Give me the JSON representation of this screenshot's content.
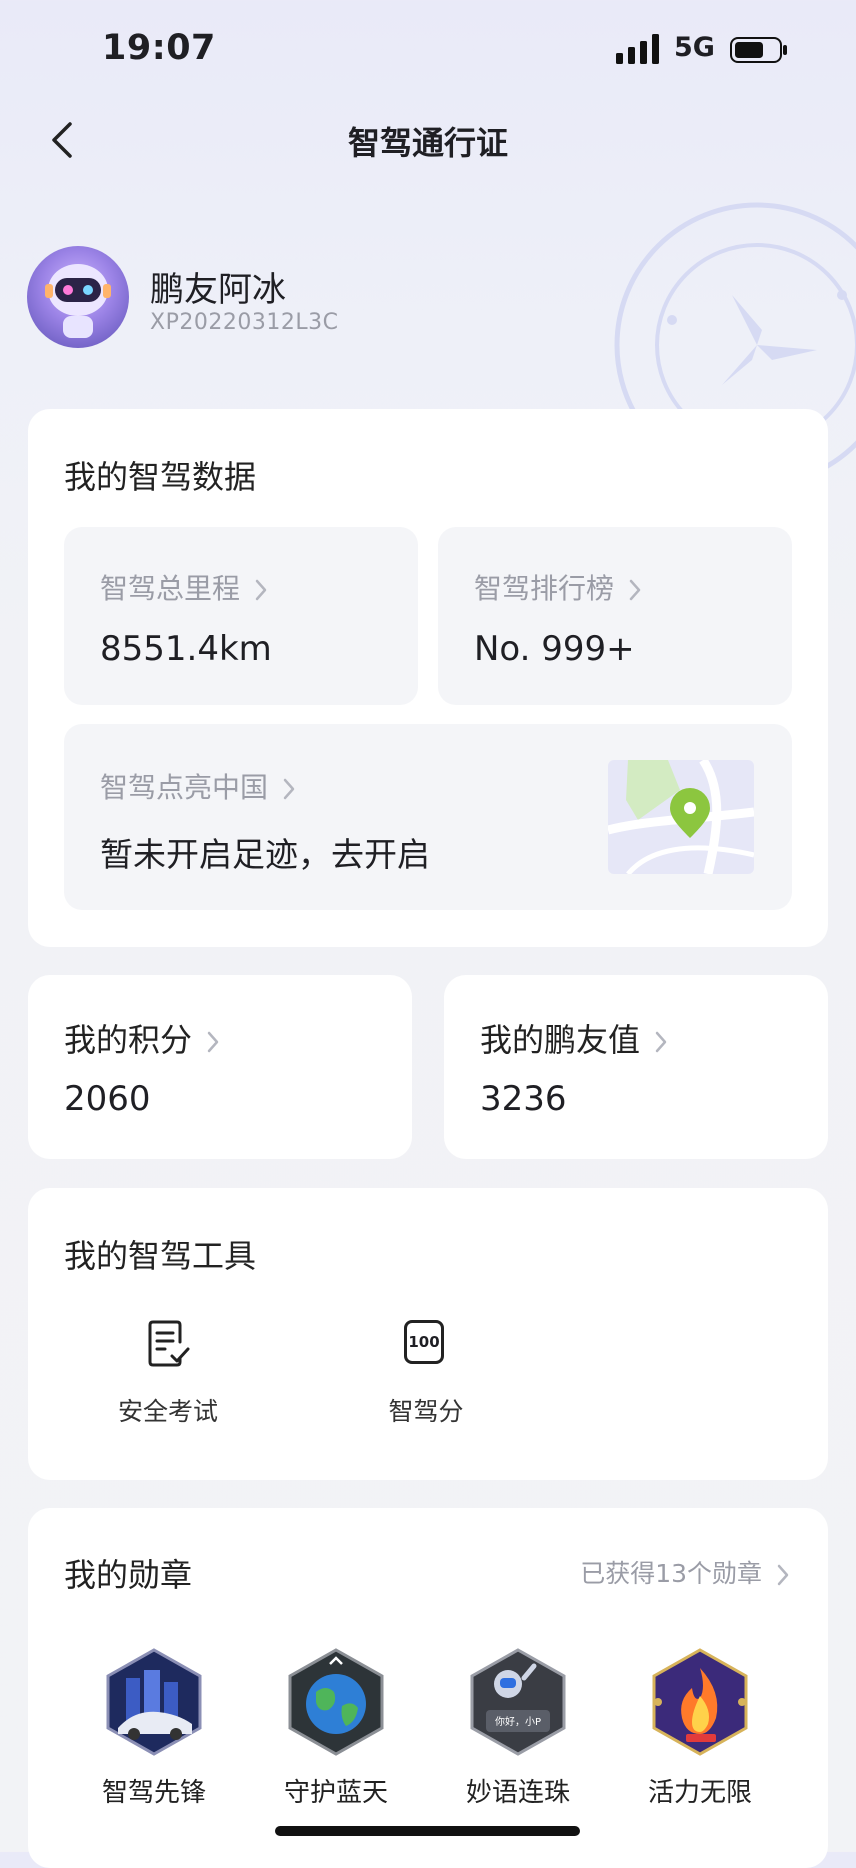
{
  "status_bar": {
    "time": "19:07",
    "network": "5G"
  },
  "nav": {
    "title": "智驾通行证"
  },
  "profile": {
    "name": "鹏友阿冰",
    "id": "XP20220312L3C"
  },
  "smart_driving_data": {
    "title": "我的智驾数据",
    "mileage": {
      "label": "智驾总里程",
      "value": "8551.4km"
    },
    "ranking": {
      "label": "智驾排行榜",
      "value": "No. 999+"
    },
    "light_up_china": {
      "label": "智驾点亮中国",
      "value": "暂未开启足迹，去开启"
    }
  },
  "points": {
    "label": "我的积分",
    "value": "2060"
  },
  "friend_value": {
    "label": "我的鹏友值",
    "value": "3236"
  },
  "tools": {
    "title": "我的智驾工具",
    "items": [
      {
        "label": "安全考试",
        "icon": "exam-checklist-icon"
      },
      {
        "label": "智驾分",
        "icon": "score-100-icon",
        "icon_text": "100"
      }
    ]
  },
  "medals": {
    "title": "我的勋章",
    "summary": "已获得13个勋章",
    "items": [
      {
        "label": "智驾先锋",
        "icon": "car-city-medal-icon"
      },
      {
        "label": "守护蓝天",
        "icon": "earth-medal-icon"
      },
      {
        "label": "妙语连珠",
        "icon": "astronaut-medal-icon",
        "icon_text": "你好，小P"
      },
      {
        "label": "活力无限",
        "icon": "fire-medal-icon"
      }
    ]
  },
  "colors": {
    "accent_green": "#8cc63f",
    "label_gray": "#9a9ca6",
    "tile_bg": "#f4f5f8"
  }
}
